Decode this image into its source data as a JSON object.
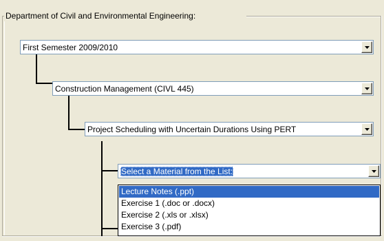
{
  "group": {
    "title": "Department of Civil and Environmental Engineering:"
  },
  "semester_select": {
    "value": "First Semester 2009/2010"
  },
  "course_select": {
    "value": "Construction Management (CIVL 445)"
  },
  "topic_select": {
    "value": "Project Scheduling with Uncertain Durations Using PERT"
  },
  "material_select": {
    "value": "Select a Material from the List:",
    "options": [
      "Lecture Notes (.ppt)",
      "Exercise 1 (.doc or .docx)",
      "Exercise 2 (.xls or .xlsx)",
      "Exercise 3 (.pdf)"
    ],
    "highlighted_index": 0
  },
  "colors": {
    "selection": "#316ac5",
    "border": "#7f9db9",
    "background": "#ece9d8"
  }
}
